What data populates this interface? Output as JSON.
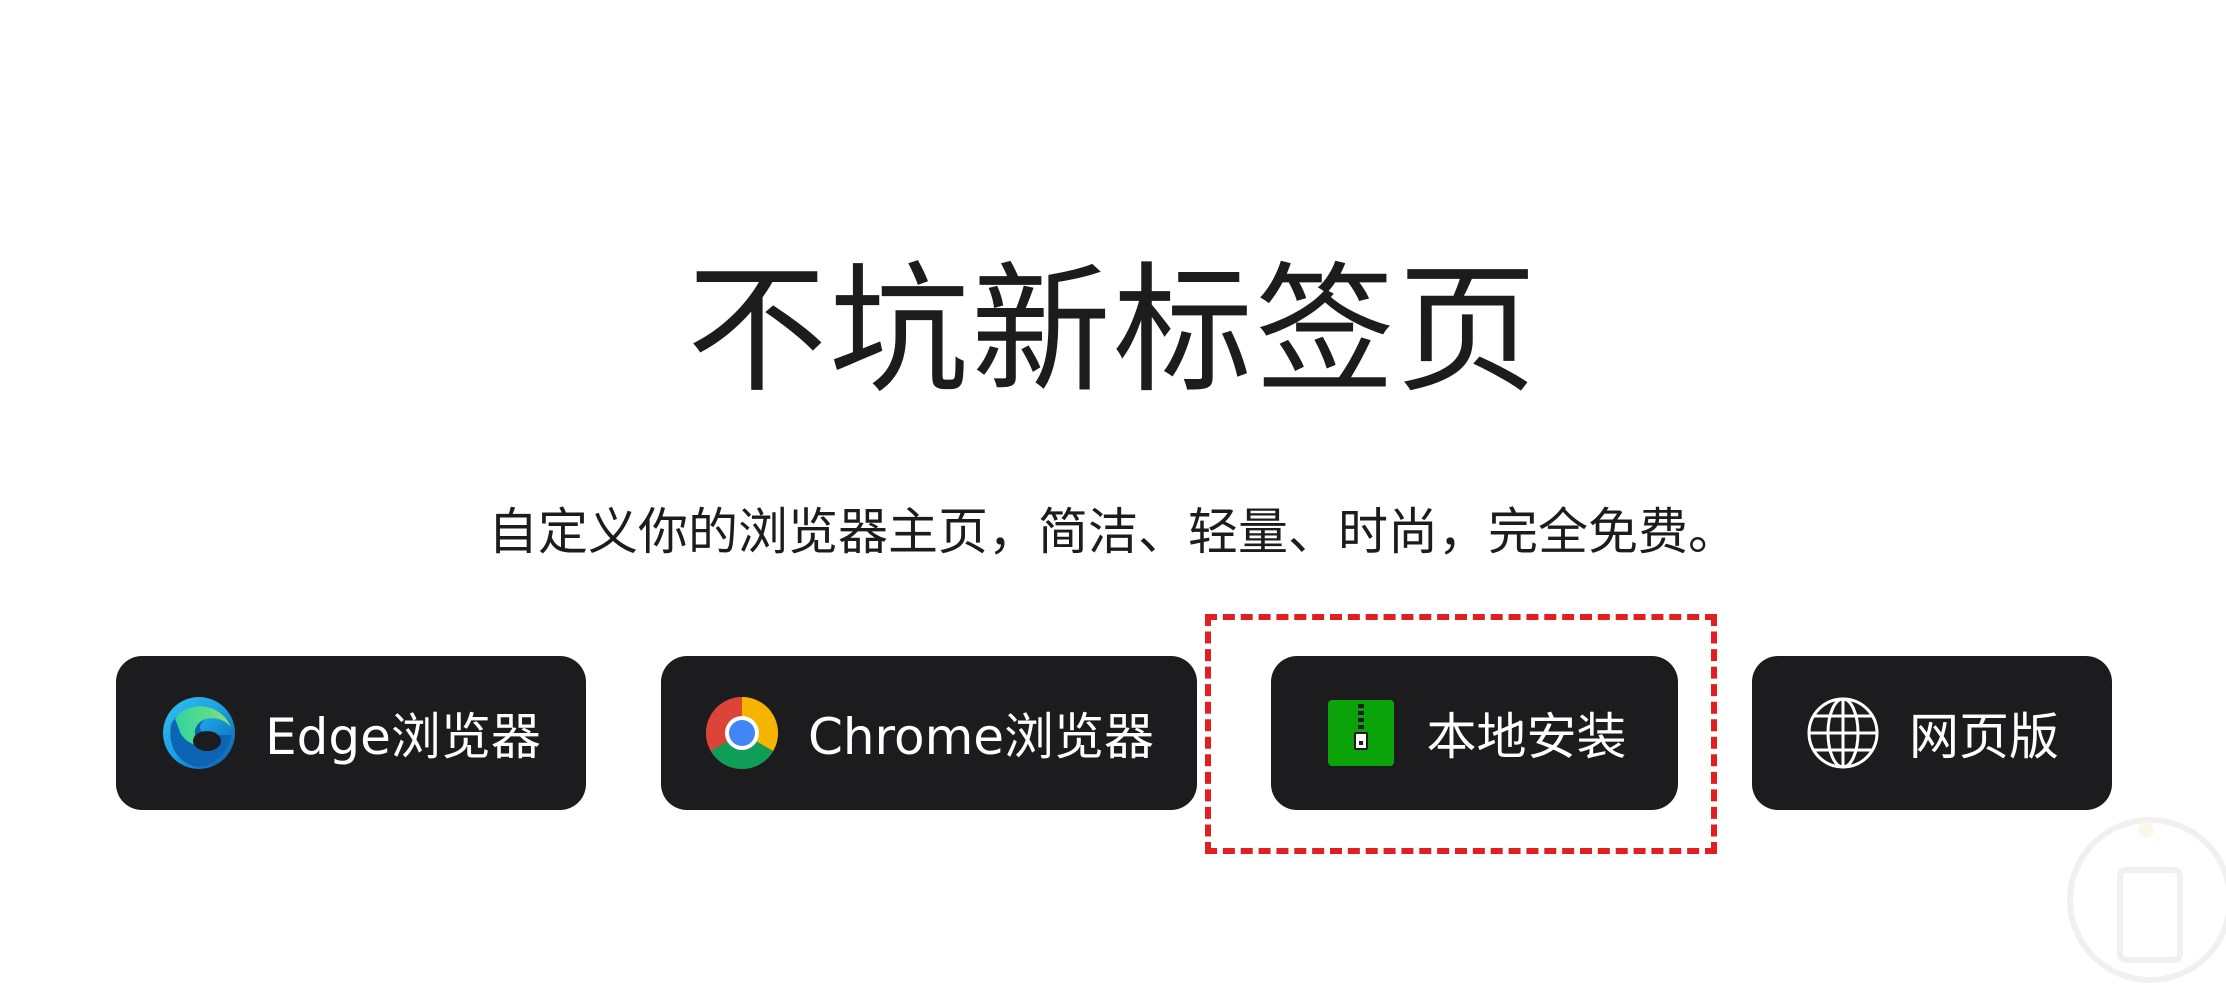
{
  "hero": {
    "title": "不坑新标签页",
    "subtitle": "自定义你的浏览器主页，简洁、轻量、时尚，完全免费。"
  },
  "buttons": [
    {
      "id": "edge",
      "label": "Edge浏览器",
      "icon": "edge-logo-icon"
    },
    {
      "id": "chrome",
      "label": "Chrome浏览器",
      "icon": "chrome-logo-icon"
    },
    {
      "id": "local",
      "label": "本地安装",
      "icon": "zip-archive-icon"
    },
    {
      "id": "web",
      "label": "网页版",
      "icon": "globe-icon"
    }
  ],
  "colors": {
    "button_bg": "#1c1c1e",
    "button_text": "#ffffff",
    "highlight": "#e02020",
    "zip_green": "#0aa30a"
  }
}
